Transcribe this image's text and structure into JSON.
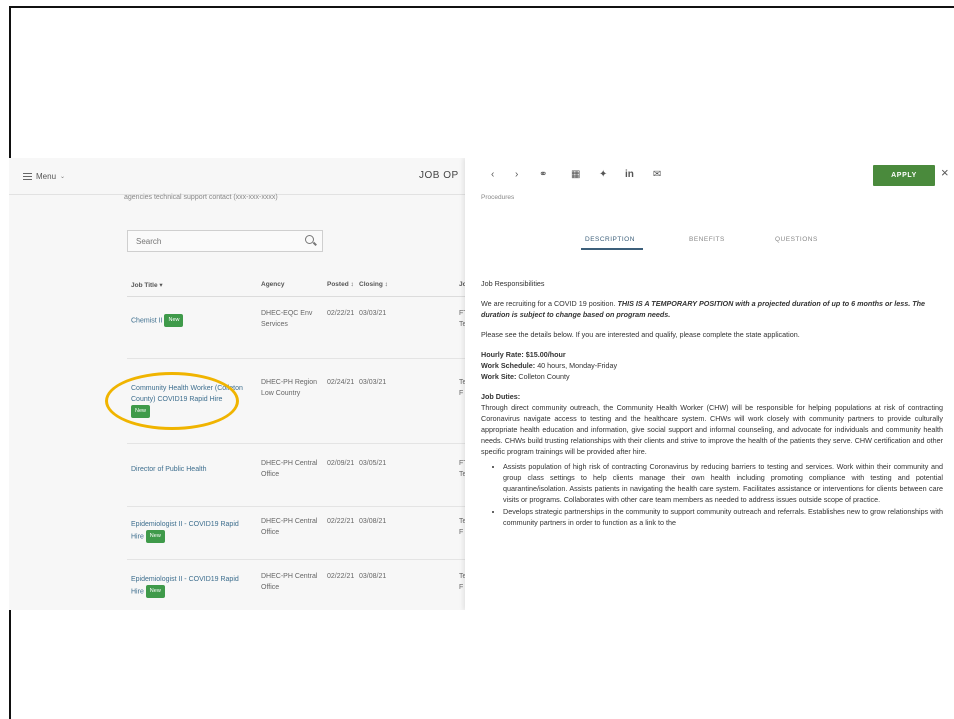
{
  "topbar": {
    "menu_label": "Menu",
    "page_title": "JOB OP"
  },
  "left": {
    "contact_line": "agencies technical support contact (xxx-xxx-xxxx)",
    "search_placeholder": "Search",
    "columns": [
      "Job Title",
      "Agency",
      "Posted",
      "Closing",
      "Job"
    ],
    "rows": [
      {
        "title": "Chemist II",
        "badge": "New",
        "agency": "DHEC-EQC Env Services",
        "posted": "02/22/21",
        "closing": "03/03/21",
        "jt": "FTE Tem"
      },
      {
        "title": "Community Health Worker (Colleton County) COVID19 Rapid Hire",
        "badge": "New",
        "agency": "DHEC-PH Region Low Country",
        "posted": "02/24/21",
        "closing": "03/03/21",
        "jt": "Tem F"
      },
      {
        "title": "Director of Public Health",
        "badge": "",
        "agency": "DHEC-PH Central Office",
        "posted": "02/09/21",
        "closing": "03/05/21",
        "jt": "FTE Tem"
      },
      {
        "title": "Epidemiologist II - COVID19 Rapid Hire",
        "badge": "New",
        "agency": "DHEC-PH Central Office",
        "posted": "02/22/21",
        "closing": "03/08/21",
        "jt": "Tem F"
      },
      {
        "title": "Epidemiologist II - COVID19 Rapid Hire",
        "badge": "New",
        "agency": "DHEC-PH Central Office",
        "posted": "02/22/21",
        "closing": "03/08/21",
        "jt": "Tem F"
      }
    ]
  },
  "panel": {
    "apply_label": "APPLY",
    "subheader": "Procedures",
    "tabs": [
      "DESCRIPTION",
      "BENEFITS",
      "QUESTIONS"
    ],
    "section_title": "Job Responsibilities",
    "intro_plain": "We are recruiting for a COVID 19 position.",
    "intro_emphasis": "THIS IS A TEMPORARY POSITION with a projected duration of up to 6 months or less. The duration is subject to change based on program needs.",
    "review_text": "Please see the details below. If you are interested and qualify, please complete the state application.",
    "hourly_label": "Hourly Rate: $15.00/hour",
    "schedule_label": "Work Schedule:",
    "schedule_value": "40 hours, Monday-Friday",
    "site_label": "Work Site:",
    "site_value": "Colleton County",
    "duties_title": "Job Duties:",
    "duties_text": "Through direct community outreach, the Community Health Worker (CHW) will be responsible for helping populations at risk of contracting Coronavirus navigate access to testing and the healthcare system. CHWs will work closely with community partners to provide culturally appropriate health education and information, give social support and informal counseling, and advocate for individuals and community health needs. CHWs build trusting relationships with their clients and strive to improve the health of the patients they serve. CHW certification and other specific program trainings will be provided after hire.",
    "bullets": [
      "Assists population of high risk of contracting Coronavirus by reducing barriers to testing and services. Work within their community and group class settings to help clients manage their own health including promoting compliance with testing and potential quarantine/isolation. Assists patients in navigating the health care system. Facilitates assistance or interventions for clients between care visits or programs. Collaborates with other care team members as needed to address issues outside scope of practice.",
      "Develops strategic partnerships in the community to support community outreach and referrals. Establishes new to grow relationships with community partners in order to function as a link to the"
    ]
  }
}
